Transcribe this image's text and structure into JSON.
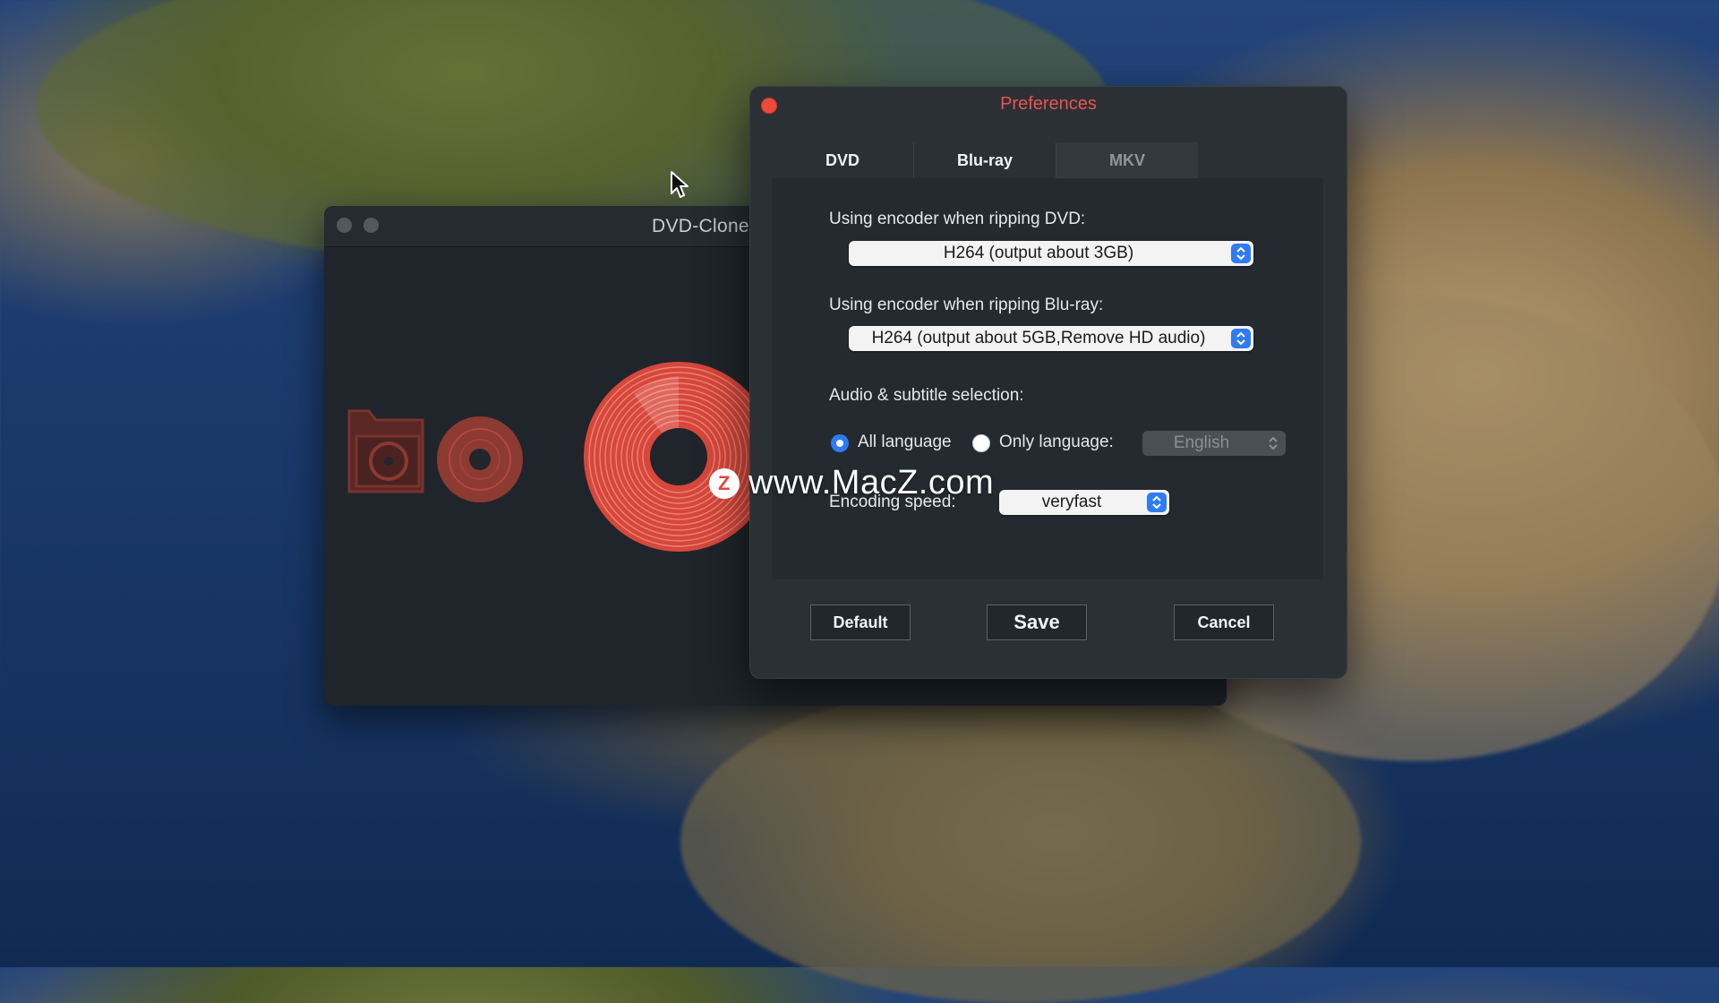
{
  "desktop": {
    "watermark": {
      "logo_letter": "Z",
      "text": "www.MacZ.com"
    }
  },
  "main_window": {
    "title": "DVD-Cloner"
  },
  "preferences": {
    "title": "Preferences",
    "title_color": "#e8554f",
    "tabs": [
      {
        "label": "DVD",
        "active": false
      },
      {
        "label": "Blu-ray",
        "active": false
      },
      {
        "label": "MKV",
        "active": true
      }
    ],
    "dvd_encoder": {
      "label": "Using encoder when ripping DVD:",
      "value": "H264 (output about 3GB)"
    },
    "bluray_encoder": {
      "label": "Using encoder when ripping Blu-ray:",
      "value": "H264 (output about 5GB,Remove HD audio)"
    },
    "audio_subtitle": {
      "label": "Audio & subtitle selection:",
      "all_language_label": "All language",
      "all_language_selected": true,
      "only_language_label": "Only language:",
      "only_language_selected": false,
      "language_value": "English"
    },
    "encoding_speed": {
      "label": "Encoding speed:",
      "value": "veryfast"
    },
    "buttons": {
      "default": "Default",
      "save": "Save",
      "cancel": "Cancel"
    },
    "accent_color": "#2f7bf4"
  }
}
